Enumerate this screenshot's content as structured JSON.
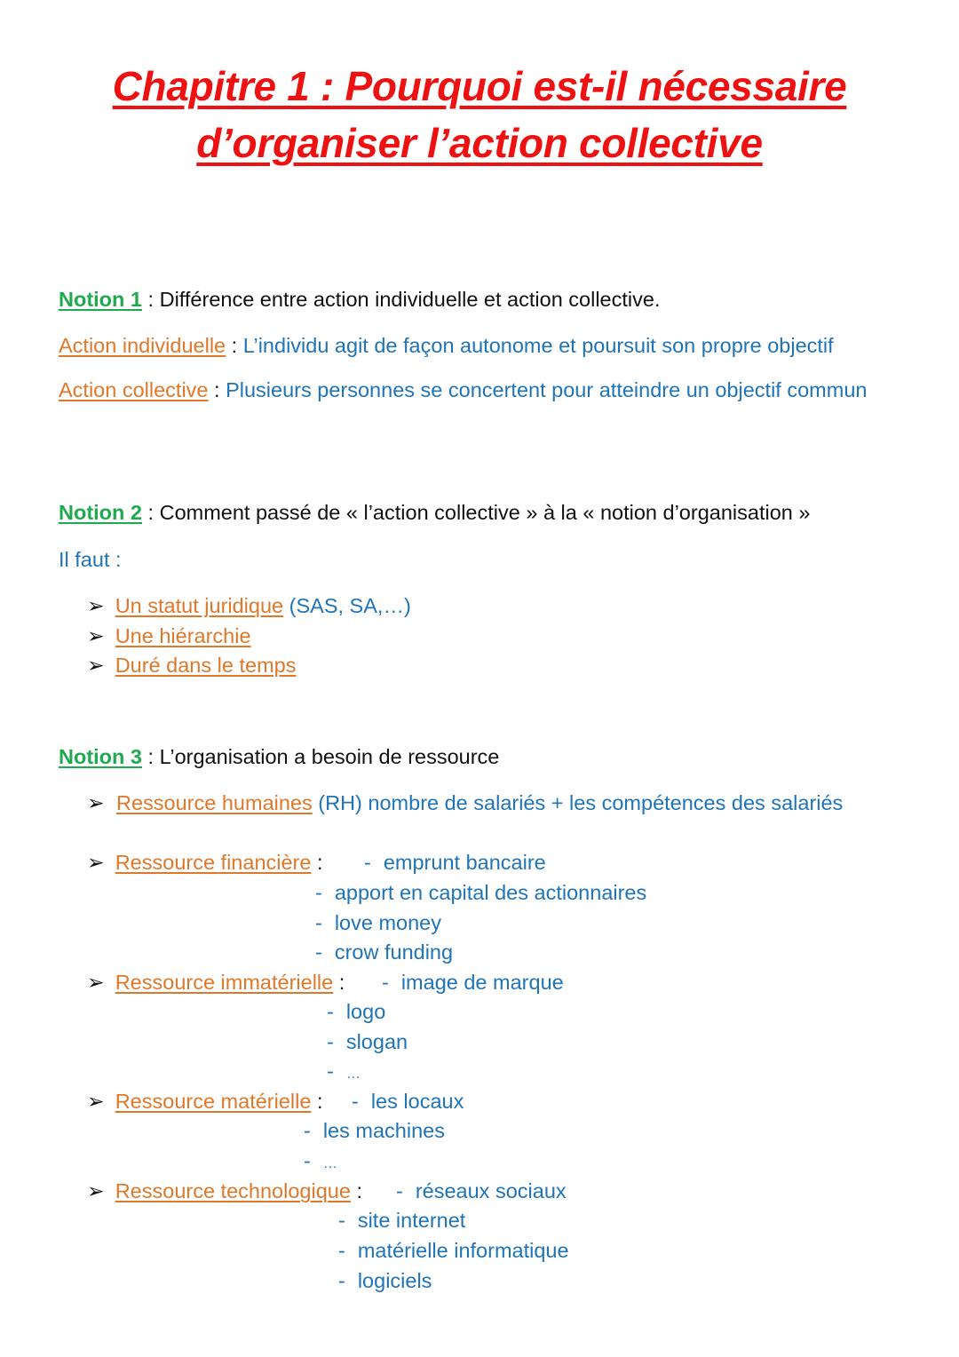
{
  "title": {
    "line1": "Chapitre 1 : Pourquoi est-il nécessaire",
    "line2": "d’organiser l’action collective"
  },
  "notion1": {
    "label": "Notion 1",
    "sep": " : ",
    "text": "Différence entre action individuelle et action collective.",
    "individuelle": {
      "term": "Action individuelle",
      "sep": " : ",
      "def": "L’individu agit de façon autonome et poursuit son propre objectif"
    },
    "collective": {
      "term": "Action collective",
      "sep": " : ",
      "def": "Plusieurs personnes se concertent pour atteindre un objectif commun"
    }
  },
  "notion2": {
    "label": "Notion 2",
    "sep": " : ",
    "text": "Comment passé de « l’action collective » à la « notion d’organisation »",
    "intro": "Il faut :",
    "bullets": [
      {
        "term": "Un statut juridique",
        "extra": " (SAS, SA,…)"
      },
      {
        "term": "Une hiérarchie",
        "extra": ""
      },
      {
        "term": "Duré dans le temps",
        "extra": ""
      }
    ]
  },
  "notion3": {
    "label": "Notion 3",
    "sep": " : ",
    "text": "L’organisation a besoin de ressource",
    "rh": {
      "term": "Ressource humaines",
      "def": "(RH) nombre de salariés + les compétences des salariés"
    },
    "financiere": {
      "term": "Ressource financière",
      "items": [
        "emprunt bancaire",
        "apport en capital des actionnaires",
        "love money",
        "crow funding"
      ]
    },
    "immaterielle": {
      "term": "Ressource immatérielle",
      "items": [
        "image de marque",
        "logo",
        "slogan",
        "…"
      ]
    },
    "materielle": {
      "term": "Ressource matérielle",
      "items": [
        "les locaux",
        "les machines",
        "…"
      ]
    },
    "technologique": {
      "term": "Ressource technologique",
      "items": [
        "réseaux sociaux",
        "site internet",
        "matérielle informatique",
        "logiciels"
      ]
    }
  },
  "symbols": {
    "bullet": "➢",
    "dash": "-",
    "colon": ":"
  },
  "colors": {
    "title": "#ee1111",
    "notion": "#1faa4f",
    "term": "#e0782a",
    "definition": "#1f74b8",
    "body": "#111111"
  }
}
